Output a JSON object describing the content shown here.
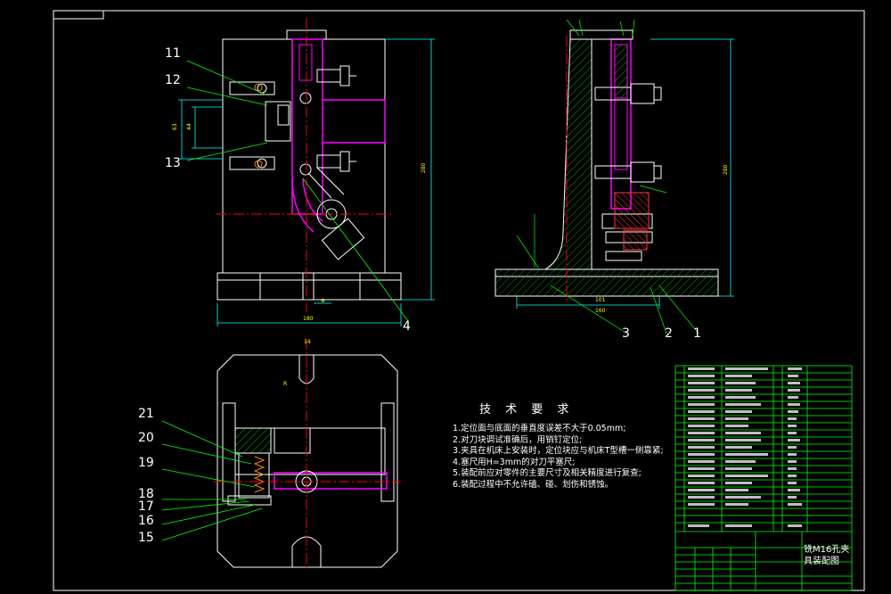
{
  "drawing": {
    "technical_requirements": {
      "title": "技 术 要 求",
      "items": [
        "1.定位面与底面的垂直度误差不大于0.05mm;",
        "2.对刀块调试准确后，用销钉定位;",
        "3.夹具在机床上安装时，定位块应与机床T型槽一侧靠紧;",
        "4.塞尺用H=3mm的对刀平塞尺;",
        "5.装配前应对零件的主要尺寸及相关精度进行复查;",
        "6.装配过程中不允许磕、碰、划伤和锈蚀。"
      ]
    },
    "balloons": {
      "b1": "1",
      "b2": "2",
      "b3": "3",
      "b4": "4",
      "b11": "11",
      "b12": "12",
      "b13": "13",
      "b15": "15",
      "b16": "16",
      "b17": "17",
      "b18": "18",
      "b19": "19",
      "b20": "20",
      "b21": "21"
    },
    "title_block": {
      "drawing_name_line1": "铣M16孔夹",
      "drawing_name_line2": "具装配图"
    },
    "colors": {
      "background": "#000000",
      "outline": "#ffffff",
      "center_line": "#ff0000",
      "part_highlight": "#ff00ff",
      "leader_lines": "#00ff00",
      "section_hatch": "#00ff00",
      "dimension": "#00ffff",
      "dimension_text": "#ffff00"
    }
  }
}
